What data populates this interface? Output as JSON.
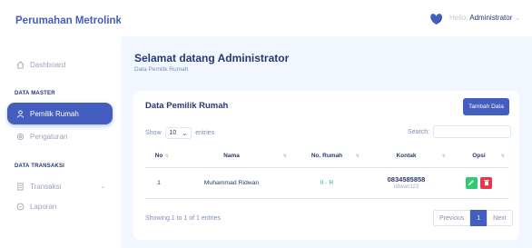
{
  "app": {
    "brand": "Perumahan Metrolink"
  },
  "sidebar": {
    "items": [
      {
        "label": "Dashboard",
        "icon": "house-icon"
      },
      {
        "label": "Pemilik Rumah",
        "icon": "person-icon",
        "active": true
      },
      {
        "label": "Pengaturan",
        "icon": "gear-icon"
      },
      {
        "label": "Transaksi",
        "icon": "document-icon"
      },
      {
        "label": "Laporan",
        "icon": "report-icon"
      }
    ],
    "sections": {
      "master": "DATA MASTER",
      "transaksi": "DATA TRANSAKSI"
    }
  },
  "topbar": {
    "greeting": "Hello,",
    "user": "Administrator"
  },
  "page": {
    "title": "Selamat datang Administrator",
    "subtitle": "Data Pemilik Rumah"
  },
  "card": {
    "title": "Data Pemilik Rumah",
    "add_button": "Tambah Data",
    "show_label": "Show",
    "entries_value": "10",
    "entries_label": "entries",
    "search_label": "Search:",
    "columns": [
      "No",
      "Nama",
      "No. Rumah",
      "Kontak",
      "Opsi"
    ],
    "rows": [
      {
        "no": "1",
        "nama": "Muhammad Ridwan",
        "no_rumah": "II - R",
        "kontak": "0834585858",
        "kontak_sub": "ridwan123"
      }
    ],
    "info": "Showing 1 to 1 of 1 entries",
    "pagination": {
      "previous": "Previous",
      "current": "1",
      "next": "Next"
    }
  },
  "colors": {
    "primary": "#435ebe",
    "edit": "#2ecc71",
    "delete": "#e8364d",
    "accent_text": "#1abc9c"
  }
}
